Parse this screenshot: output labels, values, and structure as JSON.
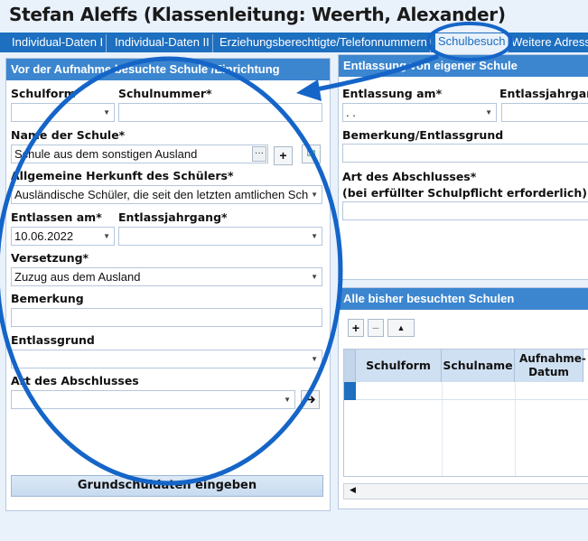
{
  "window": {
    "title": "Stefan Aleffs (Klassenleitung: Weerth, Alexander)"
  },
  "tabs": [
    {
      "label": "Individual-Daten I"
    },
    {
      "label": "Individual-Daten II"
    },
    {
      "label": "Erziehungsberechtigte/Telefonnummern"
    },
    {
      "label": "Schulbesuch"
    },
    {
      "label": "Weitere Adressen"
    }
  ],
  "active_tab": "Schulbesuch",
  "left_panel": {
    "heading": "Vor der Aufnahme besuchte Schule /Einrichtung",
    "schulform_label": "Schulform",
    "schulform_value": "",
    "schulnummer_label": "Schulnummer*",
    "schulnummer_value": "",
    "name_label": "Name der Schule*",
    "name_value": "Schule aus dem sonstigen Ausland",
    "herkunft_label": "Allgemeine Herkunft des Schülers*",
    "herkunft_value": "Ausländische Schüler, die seit den letzten amtlichen Sch",
    "entlassen_label": "Entlassen am*",
    "entlassen_value": "10.06.2022",
    "jahrgang_label": "Entlassjahrgang*",
    "jahrgang_value": "",
    "versetzung_label": "Versetzung*",
    "versetzung_value": "Zuzug aus dem Ausland",
    "bemerkung_label": "Bemerkung",
    "bemerkung_value": "",
    "entlassgrund_label": "Entlassgrund",
    "entlassgrund_value": "",
    "abschluss_label": "Art des Abschlusses",
    "abschluss_value": "",
    "grundschul_button": "Grundschuldaten eingeben"
  },
  "right_panel": {
    "heading": "Entlassung von eigener Schule",
    "entlassung_label": "Entlassung am*",
    "entlassung_value": ". .",
    "jahrgang_label": "Entlassjahrgang",
    "bemerkung_label": "Bemerkung/Entlassgrund",
    "abschluss_label": "Art des Abschlusses*",
    "abschluss_hint": "(bei erfüllter Schulpflicht erforderlich)"
  },
  "schools_panel": {
    "heading": "Alle bisher besuchten Schulen",
    "columns": [
      "Schulform",
      "Schulname",
      "Aufnahme-Datum"
    ]
  },
  "colors": {
    "accent": "#1d6fc0",
    "header": "#3c86d0",
    "annotation": "#1565c8"
  }
}
